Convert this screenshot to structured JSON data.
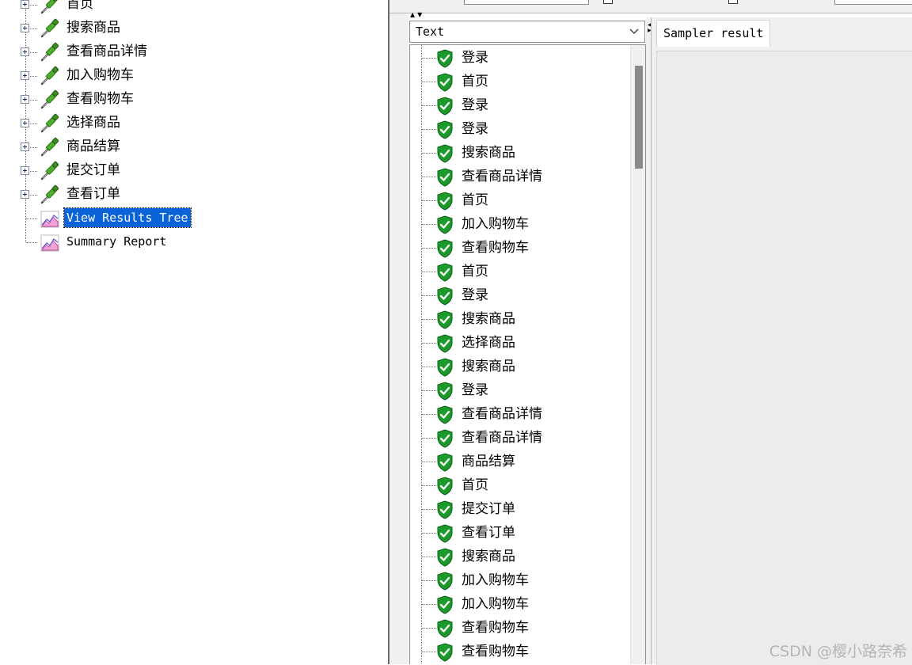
{
  "test_plan_tree": {
    "samplers": [
      "首页",
      "搜索商品",
      "查看商品详情",
      "加入购物车",
      "查看购物车",
      "选择商品",
      "商品结算",
      "提交订单",
      "查看订单"
    ],
    "listeners": [
      {
        "label": "View Results Tree",
        "selected": true
      },
      {
        "label": "Summary Report",
        "selected": false
      }
    ]
  },
  "renderer": {
    "selected": "Text"
  },
  "results_tree": {
    "items": [
      "登录",
      "首页",
      "登录",
      "登录",
      "搜索商品",
      "查看商品详情",
      "首页",
      "加入购物车",
      "查看购物车",
      "首页",
      "登录",
      "搜索商品",
      "选择商品",
      "搜索商品",
      "登录",
      "查看商品详情",
      "查看商品详情",
      "商品结算",
      "首页",
      "提交订单",
      "查看订单",
      "搜索商品",
      "加入购物车",
      "加入购物车",
      "查看购物车",
      "查看购物车"
    ],
    "status": "success"
  },
  "result_panel": {
    "tab_label": "Sampler result"
  },
  "watermark": "CSDN @樱小路奈希",
  "icons": {
    "sampler": "pipette-icon",
    "listener": "graph-icon",
    "result_status": "shield-check-icon",
    "expand": "plus-icon",
    "dropdown": "chevron-down-icon"
  },
  "colors": {
    "selection": "#0a64d8",
    "success_green": "#1a9a2a",
    "panel_bg": "#f0f0f0"
  }
}
